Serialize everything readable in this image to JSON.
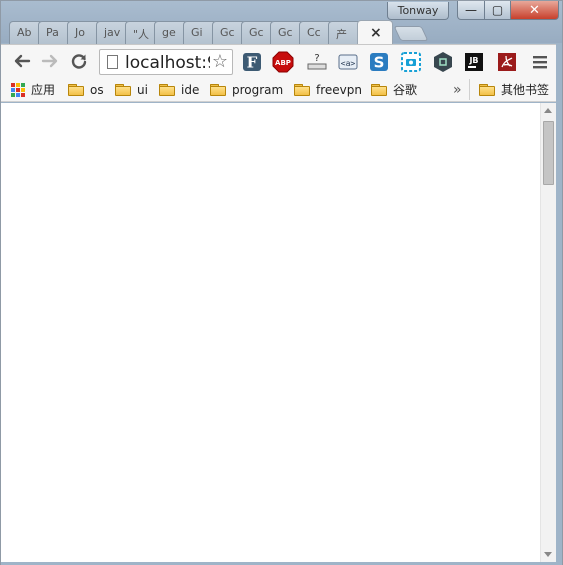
{
  "window": {
    "profile_name": "Tonway",
    "controls": {
      "minimize": "—",
      "maximize": "▢",
      "close": "✕"
    }
  },
  "tabs": [
    {
      "label": "Ab"
    },
    {
      "label": "Pa"
    },
    {
      "label": "Jo"
    },
    {
      "label": "jav"
    },
    {
      "label": "\"人"
    },
    {
      "label": "ge"
    },
    {
      "label": "Gi"
    },
    {
      "label": "Gc"
    },
    {
      "label": "Gc"
    },
    {
      "label": "Gc"
    },
    {
      "label": "Cc"
    },
    {
      "label": "产"
    },
    {
      "label": "×",
      "active": true
    }
  ],
  "toolbar": {
    "back": "←",
    "forward": "→",
    "reload": "C",
    "url": "localhost:9",
    "star": "☆",
    "extensions": [
      {
        "name": "f-icon",
        "text": "F"
      },
      {
        "name": "abp-icon",
        "text": "ABP"
      },
      {
        "name": "question-icon",
        "text": "?"
      },
      {
        "name": "tag-icon",
        "text": "<a>"
      },
      {
        "name": "s-icon",
        "text": "S"
      },
      {
        "name": "camera-icon",
        "text": ""
      },
      {
        "name": "shield-icon",
        "text": ""
      },
      {
        "name": "jb-icon",
        "text": "JB"
      },
      {
        "name": "pdf-icon",
        "text": ""
      }
    ],
    "menu": "≡"
  },
  "bookmarks": {
    "apps_label": "应用",
    "folders": [
      "os",
      "ui",
      "ide",
      "program",
      "freevpn",
      "谷歌"
    ],
    "overflow": "»",
    "other": "其他书签"
  },
  "colors": {
    "accent": "#d9261c",
    "abp": "#c70d0d",
    "s_blue": "#2b7cc0",
    "jb_black": "#111111",
    "pdf_red": "#9b1b1b"
  }
}
